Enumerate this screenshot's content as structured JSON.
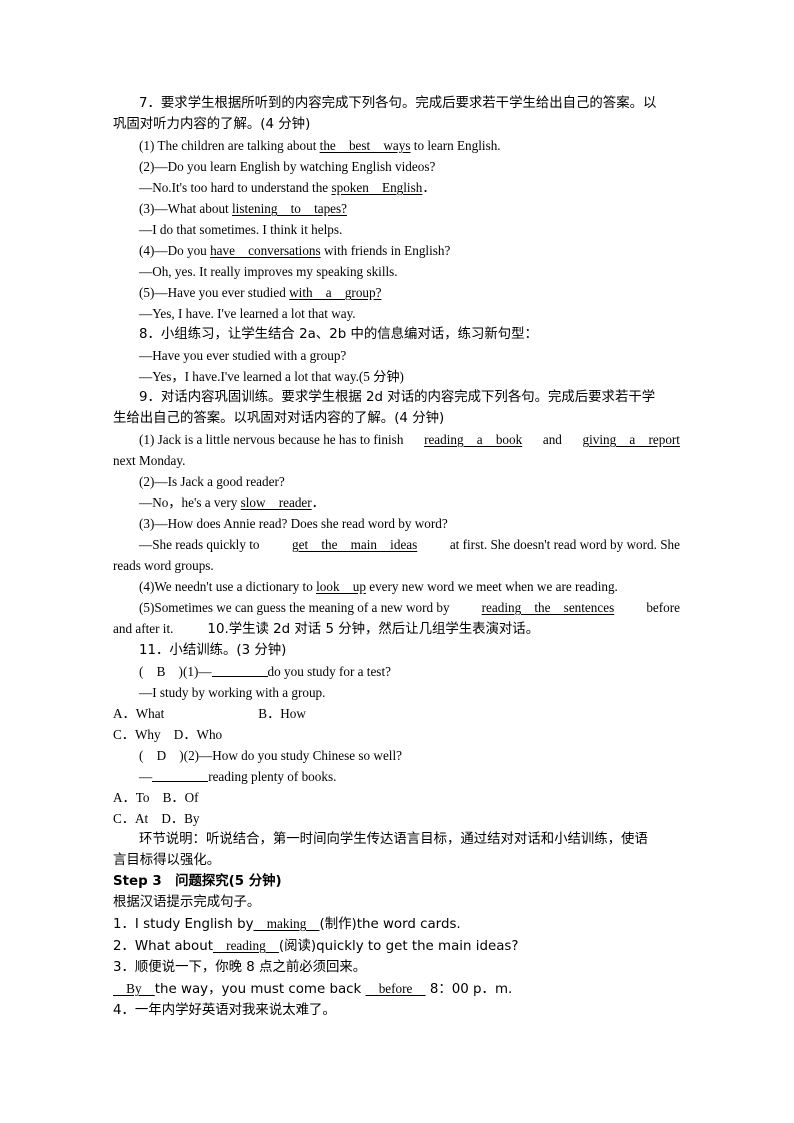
{
  "document": {
    "type": "lesson-plan-page",
    "language": "zh-CN with English exercises",
    "lines": {
      "l1a": "7．要求学生根据所听到的内容完成下列各句。完成后要求若干学生给出自己的答案。以",
      "l1b": "巩固对听力内容的了解。(4 分钟)",
      "q7_1_pre": "(1) The children are talking about ",
      "q7_1_ans": "the　best　ways",
      "q7_1_post": " to learn English.",
      "q7_2": "(2)—Do you learn English by watching English videos?",
      "q7_2a_pre": "—No.It's too hard to understand the ",
      "q7_2a_ans": "spoken　English",
      "q7_2a_post": "．",
      "q7_3_pre": "(3)—What about ",
      "q7_3_ans": "listening　to　tapes?",
      "q7_3a": "—I do that sometimes. I think it helps.",
      "q7_4_pre": "(4)—Do you ",
      "q7_4_ans": "have　conversations",
      "q7_4_post": " with friends in English?",
      "q7_4a": "—Oh, yes. It really improves my speaking skills.",
      "q7_5_pre": "(5)—Have you ever studied ",
      "q7_5_ans": "with　a　group?",
      "q7_5a": "—Yes, I have. I've learned a lot that way.",
      "l8": "8．小组练习，让学生结合 2a、2b 中的信息编对话，练习新句型：",
      "l8a": "—Have you ever studied with a group?",
      "l8b": "—Yes，I have.I've learned a lot that way.(5 分钟)",
      "l9a": "9．对话内容巩固训练。要求学生根据 2d 对话的内容完成下列各句。完成后要求若干学",
      "l9b": "生给出自己的答案。以巩固对对话内容的了解。(4 分钟)",
      "q9_1_pre": "(1) Jack is a little nervous because he has to finish ",
      "q9_1_ans1": "reading　a　book",
      "q9_1_mid": " and ",
      "q9_1_ans2": "giving　a　report",
      "q9_1_cont": "next Monday.",
      "q9_2": "(2)—Is Jack a good reader?",
      "q9_2a_pre": "—No，he's a very ",
      "q9_2a_ans": "slow　reader",
      "q9_2a_post": "．",
      "q9_3": "(3)—How does Annie read? Does she read word by word?",
      "q9_3a_pre": "—She reads quickly to ",
      "q9_3a_ans": "get　the　main　ideas",
      "q9_3a_post": " at first. She doesn't read word by word. She",
      "q9_3a_cont": "reads word groups.",
      "q9_4_pre": "(4)We needn't use a dictionary to ",
      "q9_4_ans": "look　up",
      "q9_4_post": " every new word we meet when we are reading.",
      "q9_5_pre": "(5)Sometimes we can guess the meaning of a new word by ",
      "q9_5_ans": "reading　the　sentences",
      "q9_5_post": " before",
      "q9_5_cont_a": "and after it.",
      "q9_5_cont_b": "10.学生读 2d 对话 5 分钟，然后让几组学生表演对话。",
      "l11": "11．小结训练。(3 分钟)",
      "mc1_mark": "(　B　)(1)—",
      "mc1_post": "do you study for a test?",
      "mc1_answer_line": "—I study by working with a group.",
      "mc1_optA": "A．What",
      "mc1_optB": "B．How",
      "mc1_optC": "C．Why　D．Who",
      "mc2_mark": "(　D　)(2)—How do you study Chinese so well?",
      "mc2_pre": "—",
      "mc2_post": "reading plenty of books.",
      "mc2_optAB": "A．To　B．Of",
      "mc2_optCD": "C．At　D．By",
      "note_a": "环节说明：听说结合，第一时间向学生传达语言目标，通过结对对话和小结训练，使语",
      "note_b": "言目标得以强化。",
      "step3": "Step 3　问题探究(5 分钟)",
      "step3_sub": "根据汉语提示完成句子。",
      "s3_1_pre": "1．I study English by",
      "s3_1_ans": "　making　",
      "s3_1_post": "(制作)the word cards.",
      "s3_2_pre": "2．What about",
      "s3_2_ans": "　reading　",
      "s3_2_post": "(阅读)quickly to get the main ideas?",
      "s3_3": "3．顺便说一下，你晚 8 点之前必须回来。",
      "s3_3a_ans1": "　By　",
      "s3_3a_mid": "the way，you must come back ",
      "s3_3a_ans2": "　before　",
      "s3_3a_post": " 8：00 p．m.",
      "s3_4": "4．一年内学好英语对我来说太难了。"
    }
  }
}
